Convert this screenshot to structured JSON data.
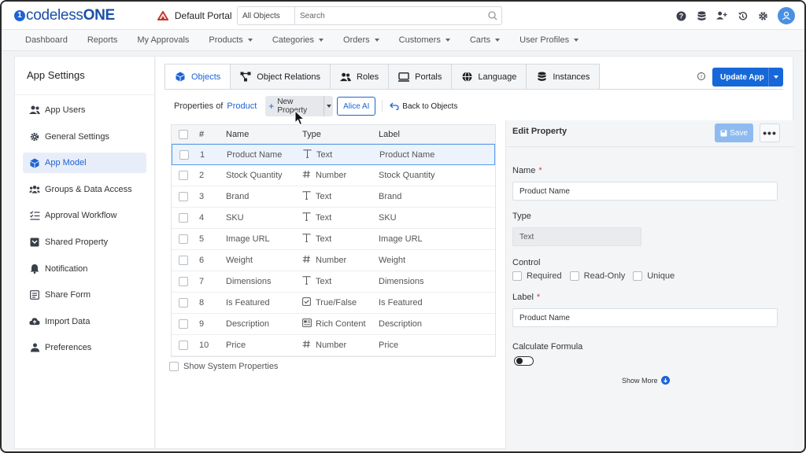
{
  "header": {
    "logo_mark": "1",
    "logo_text_a": "codeless",
    "logo_text_b": "ONE",
    "portal": "Default Portal",
    "search_scope": "All Objects",
    "search_placeholder": "Search"
  },
  "nav": {
    "items": [
      {
        "label": "Dashboard",
        "dropdown": false
      },
      {
        "label": "Reports",
        "dropdown": false
      },
      {
        "label": "My Approvals",
        "dropdown": false
      },
      {
        "label": "Products",
        "dropdown": true
      },
      {
        "label": "Categories",
        "dropdown": true
      },
      {
        "label": "Orders",
        "dropdown": true
      },
      {
        "label": "Customers",
        "dropdown": true
      },
      {
        "label": "Carts",
        "dropdown": true
      },
      {
        "label": "User Profiles",
        "dropdown": true
      }
    ]
  },
  "sidebar": {
    "title": "App Settings",
    "items": [
      {
        "label": "App Users",
        "icon": "users-icon"
      },
      {
        "label": "General Settings",
        "icon": "gear-icon"
      },
      {
        "label": "App Model",
        "icon": "cube-icon",
        "active": true
      },
      {
        "label": "Groups & Data Access",
        "icon": "group-icon"
      },
      {
        "label": "Approval Workflow",
        "icon": "checklist-icon"
      },
      {
        "label": "Shared Property",
        "icon": "share-box-icon"
      },
      {
        "label": "Notification",
        "icon": "bell-icon"
      },
      {
        "label": "Share Form",
        "icon": "form-icon"
      },
      {
        "label": "Import Data",
        "icon": "cloud-upload-icon"
      },
      {
        "label": "Preferences",
        "icon": "user-preferences-icon"
      }
    ]
  },
  "tabs": [
    {
      "label": "Objects",
      "icon": "cube-icon",
      "active": true
    },
    {
      "label": "Object Relations",
      "icon": "relations-icon"
    },
    {
      "label": "Roles",
      "icon": "roles-icon"
    },
    {
      "label": "Portals",
      "icon": "monitor-icon"
    },
    {
      "label": "Language",
      "icon": "globe-icon"
    },
    {
      "label": "Instances",
      "icon": "database-icon"
    }
  ],
  "update_app_label": "Update App",
  "toolbar": {
    "properties_of": "Properties of",
    "object_name": "Product",
    "new_property": "New Property",
    "alice_ai": "Alice AI",
    "back_to_objects": "Back to Objects"
  },
  "table": {
    "columns": {
      "num": "#",
      "name": "Name",
      "type": "Type",
      "label": "Label"
    },
    "rows": [
      {
        "num": "1",
        "name": "Product Name",
        "type": "Text",
        "type_icon": "text-type-icon",
        "label": "Product Name",
        "selected": true
      },
      {
        "num": "2",
        "name": "Stock Quantity",
        "type": "Number",
        "type_icon": "number-type-icon",
        "label": "Stock Quantity"
      },
      {
        "num": "3",
        "name": "Brand",
        "type": "Text",
        "type_icon": "text-type-icon",
        "label": "Brand"
      },
      {
        "num": "4",
        "name": "SKU",
        "type": "Text",
        "type_icon": "text-type-icon",
        "label": "SKU"
      },
      {
        "num": "5",
        "name": "Image URL",
        "type": "Text",
        "type_icon": "text-type-icon",
        "label": "Image URL"
      },
      {
        "num": "6",
        "name": "Weight",
        "type": "Number",
        "type_icon": "number-type-icon",
        "label": "Weight"
      },
      {
        "num": "7",
        "name": "Dimensions",
        "type": "Text",
        "type_icon": "text-type-icon",
        "label": "Dimensions"
      },
      {
        "num": "8",
        "name": "Is Featured",
        "type": "True/False",
        "type_icon": "checkbox-type-icon",
        "label": "Is Featured"
      },
      {
        "num": "9",
        "name": "Description",
        "type": "Rich Content",
        "type_icon": "rich-content-type-icon",
        "label": "Description"
      },
      {
        "num": "10",
        "name": "Price",
        "type": "Number",
        "type_icon": "number-type-icon",
        "label": "Price"
      }
    ],
    "show_system_properties": "Show System Properties"
  },
  "edit_panel": {
    "title": "Edit Property",
    "save": "Save",
    "more": "•••",
    "name_label": "Name",
    "name_value": "Product Name",
    "type_label": "Type",
    "type_value": "Text",
    "control_label": "Control",
    "controls": [
      "Required",
      "Read-Only",
      "Unique"
    ],
    "label_label": "Label",
    "label_value": "Product Name",
    "formula_label": "Calculate Formula",
    "show_more": "Show More",
    "required_mark": "*"
  },
  "colors": {
    "accent": "#1668d9",
    "brand": "#1a4fa8",
    "required": "#d63b3b"
  }
}
